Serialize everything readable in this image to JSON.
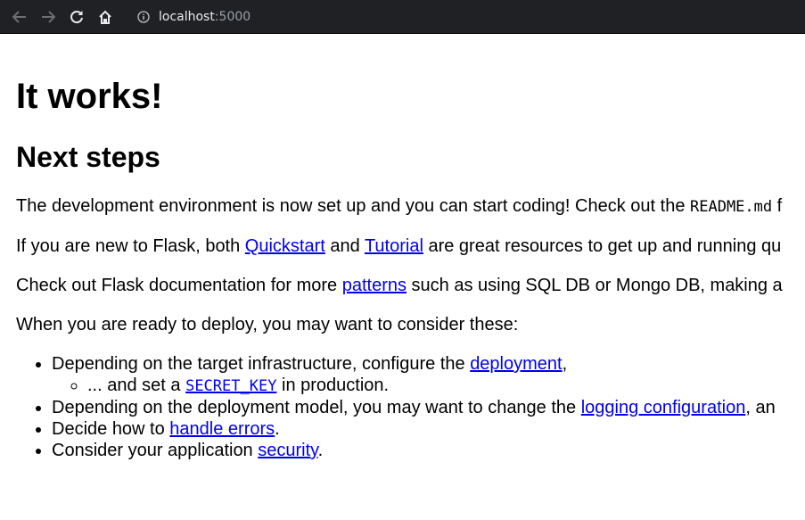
{
  "browser": {
    "url_host": "localhost",
    "url_port": ":5000"
  },
  "page": {
    "title": "It works!",
    "subtitle": "Next steps",
    "p1": {
      "before": "The development environment is now set up and you can start coding! Check out the ",
      "code": "README.md",
      "after": " f"
    },
    "p2": {
      "before": "If you are new to Flask, both ",
      "link1": "Quickstart",
      "middle": " and ",
      "link2": "Tutorial",
      "after": " are great resources to get up and running qu"
    },
    "p3": {
      "before": "Check out Flask documentation for more ",
      "link": "patterns",
      "after": " such as using SQL DB or Mongo DB, making a"
    },
    "p4": "When you are ready to deploy, you may want to consider these:",
    "list": {
      "item1": {
        "before": "Depending on the target infrastructure, configure the ",
        "link": "deployment",
        "after": ","
      },
      "subitem": {
        "before": "... and set a ",
        "link": "SECRET_KEY",
        "after": " in production."
      },
      "item2": {
        "before": "Depending on the deployment model, you may want to change the ",
        "link": "logging configuration",
        "after": ", an"
      },
      "item3": {
        "before": "Decide how to ",
        "link": "handle errors",
        "after": "."
      },
      "item4": {
        "before": "Consider your application ",
        "link": "security",
        "after": "."
      }
    }
  }
}
